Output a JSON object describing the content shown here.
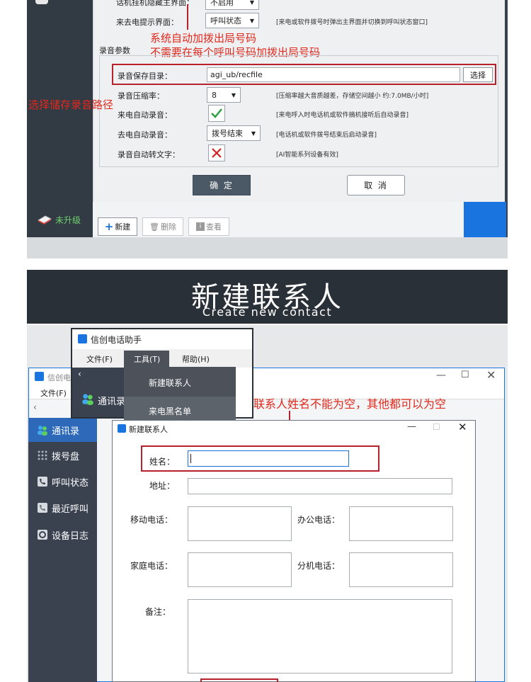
{
  "top_dialog": {
    "row_hide_label": "话机挂机隐藏主界面：",
    "row_hide_value": "不启用",
    "row_popup_label": "来去电提示界面：",
    "row_popup_value": "呼叫状态",
    "row_popup_note": "[来电或软件拨号时弹出主界面并切换到呼叫状态窗口]",
    "recording_section": "录音参数",
    "save_dir_label": "录音保存目录：",
    "save_dir_value": "agi_ub/recfile",
    "choose_button": "选择",
    "compression_label": "录音压缩率：",
    "compression_value": "8",
    "compression_note": "[压缩率越大音质越差，存储空间越小 约:7.0MB/小时]",
    "incoming_label": "来电自动录音：",
    "incoming_note": "[来电呼入时电话机或软件摘机接听后自动录音]",
    "outgoing_label": "去电自动录音：",
    "outgoing_value": "拨号结束",
    "outgoing_note": "[电话机或软件拨号结束后启动录音]",
    "transcribe_label": "录音自动转文字：",
    "transcribe_note": "[AI智能系列设备有效]",
    "ok_button": "确 定",
    "cancel_button": "取 消",
    "upgrade_label": "未升级",
    "tb_new": "新建",
    "tb_delete": "删除",
    "tb_view": "查看"
  },
  "annotations": {
    "auto_prefix_1": "系统自动加拨出局号码",
    "auto_prefix_2": "不需要在每个呼叫号码加拨出局号码",
    "choose_path": "选择储存录音路径",
    "name_required": "联系人姓名不能为空，其他都可以为空"
  },
  "banner": {
    "title": "新建联系人",
    "subtitle": "Create new contact"
  },
  "menu_window": {
    "title": "信创电话助手",
    "menus": [
      "文件(F)",
      "工具(T)",
      "帮助(H)"
    ],
    "dropdown": [
      "新建联系人",
      "来电黑名单"
    ]
  },
  "bg_window": {
    "title": "信创电话",
    "menu_file": "文件(F)",
    "sidebar_header": "通讯录",
    "sidebar": [
      "通讯录",
      "拨号盘",
      "呼叫状态",
      "最近呼叫",
      "设备日志"
    ]
  },
  "new_contact_dialog": {
    "title": "新建联系人",
    "name_label": "姓名：",
    "address_label": "地址：",
    "mobile_label": "移动电话：",
    "office_label": "办公电话：",
    "home_label": "家庭电话：",
    "ext_label": "分机电话：",
    "remark_label": "备注："
  },
  "colors": {
    "annotation_red": "#e0281c",
    "accent_blue": "#1a74e0",
    "check_green": "#2ea043",
    "cross_red": "#d32020"
  }
}
